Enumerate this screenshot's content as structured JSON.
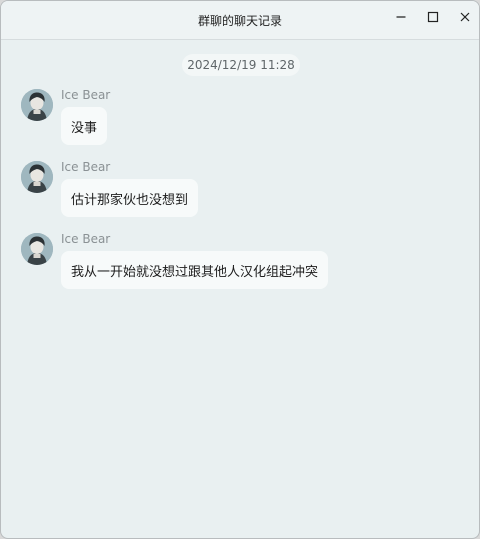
{
  "window": {
    "title": "群聊的聊天记录"
  },
  "timestamp": "2024/12/19 11:28",
  "messages": [
    {
      "sender": "Ice Bear",
      "text": "没事"
    },
    {
      "sender": "Ice Bear",
      "text": "估计那家伙也没想到"
    },
    {
      "sender": "Ice Bear",
      "text": "我从一开始就没想过跟其他人汉化组起冲突"
    }
  ],
  "colors": {
    "background": "#e9f0f1",
    "bubble": "#f7fafa",
    "sender_text": "#8a9194"
  }
}
